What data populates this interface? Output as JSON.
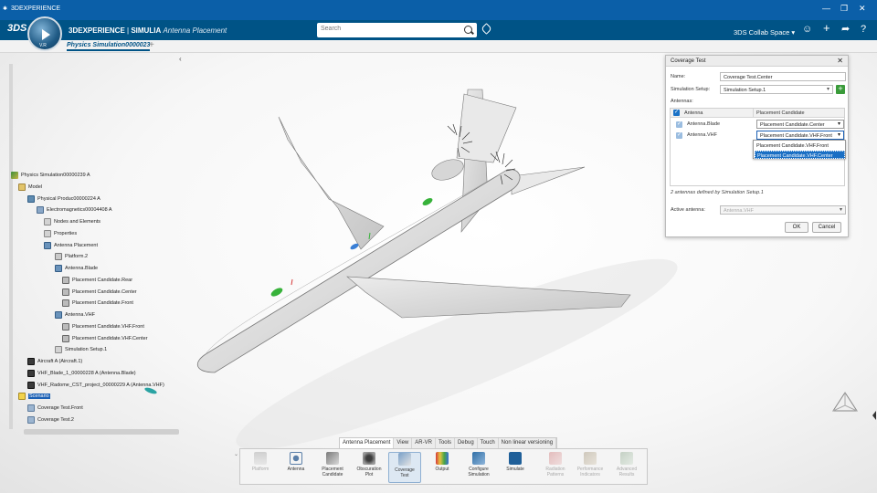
{
  "os": {
    "title": "3DEXPERIENCE",
    "controls": [
      "—",
      "❐",
      "✕"
    ]
  },
  "header": {
    "brand_main": "3DEXPERIENCE",
    "brand_sep": " | ",
    "brand_product": "SIMULIA",
    "app_name": "Antenna Placement",
    "compass_version": "V.R",
    "search_placeholder": "Search",
    "space": "3DS Collab Space",
    "icons": [
      "user-icon",
      "add-icon",
      "share-icon",
      "help-icon"
    ]
  },
  "tabs": {
    "active": "Physics Simulation0000023",
    "add": "+"
  },
  "tree": {
    "collapse_glyph": "‹",
    "nodes": [
      {
        "label": "Physics Simulation00000239 A",
        "icon": "simulation-icon",
        "depth": 0
      },
      {
        "label": "Model",
        "icon": "folder-icon",
        "depth": 1
      },
      {
        "label": "Physical Produc00000224 A",
        "icon": "product-icon",
        "depth": 2
      },
      {
        "label": "Electromagnetics00004408 A",
        "icon": "electromagnetics-icon",
        "depth": 3
      },
      {
        "label": "Nodes and Elements",
        "icon": "nodes-icon",
        "depth": 4
      },
      {
        "label": "Properties",
        "icon": "properties-icon",
        "depth": 4
      },
      {
        "label": "Antenna Placement",
        "icon": "antenna-placement-icon",
        "depth": 4
      },
      {
        "label": "Platform.2",
        "icon": "platform-icon",
        "depth": 5
      },
      {
        "label": "Antenna.Blade",
        "icon": "antenna-icon",
        "depth": 5
      },
      {
        "label": "Placement Candidate.Rear",
        "icon": "placement-candidate-icon",
        "depth": 6
      },
      {
        "label": "Placement Candidate.Center",
        "icon": "placement-candidate-icon",
        "depth": 6
      },
      {
        "label": "Placement Candidate.Front",
        "icon": "placement-candidate-icon",
        "depth": 6
      },
      {
        "label": "Antenna.VHF",
        "icon": "antenna-icon",
        "depth": 5
      },
      {
        "label": "Placement Candidate.VHF.Front",
        "icon": "placement-candidate-icon",
        "depth": 6
      },
      {
        "label": "Placement Candidate.VHF.Center",
        "icon": "placement-candidate-icon",
        "depth": 6
      },
      {
        "label": "Simulation Setup.1",
        "icon": "simulation-setup-icon",
        "depth": 5
      },
      {
        "label": "Aircraft A (Aircraft.1)",
        "icon": "part-icon",
        "depth": 2
      },
      {
        "label": "VHF_Blade_1_00000228 A (Antenna.Blade)",
        "icon": "part-icon",
        "depth": 2
      },
      {
        "label": "VHF_Radome_CST_project_00000229 A (Antenna.VHF)",
        "icon": "part-icon",
        "depth": 2
      },
      {
        "label": "Scenario",
        "icon": "scenario-icon",
        "depth": 1,
        "selected": true
      },
      {
        "label": "Coverage Test.Front",
        "icon": "coverage-icon",
        "depth": 2
      },
      {
        "label": "Coverage Test.2",
        "icon": "coverage-icon",
        "depth": 2
      }
    ]
  },
  "dialog": {
    "title": "Coverage Test",
    "close": "✕",
    "name_label": "Name:",
    "name_value": "Coverage Test.Center",
    "setup_label": "Simulation Setup:",
    "setup_value": "Simulation Setup.1",
    "add_glyph": "+",
    "antennas_label": "Antennas:",
    "col_antenna": "Antenna",
    "col_candidate": "Placement Candidate",
    "rows": [
      {
        "antenna": "Antenna.Blade",
        "candidate": "Placement Candidate.Center"
      },
      {
        "antenna": "Antenna.VHF",
        "candidate": "Placement Candidate.VHF.Front"
      }
    ],
    "options": [
      "Placement Candidate.VHF.Front",
      "Placement Candidate.VHF.Center"
    ],
    "highlighted_option": 1,
    "note": "2 antennas defined by Simulation Setup.1",
    "active_label": "Active antenna:",
    "active_value": "Antenna.VHF",
    "ok": "OK",
    "cancel": "Cancel"
  },
  "toolbar": {
    "tabs": [
      "Antenna Placement",
      "View",
      "AR-VR",
      "Tools",
      "Debug",
      "Touch",
      "Non linear versioning"
    ],
    "active_tab": 0,
    "tools": [
      {
        "label": "Platform",
        "icon": "platform-icon",
        "enabled": false
      },
      {
        "label": "Antenna",
        "icon": "antenna-icon",
        "enabled": true
      },
      {
        "label": "Placement\nCandidate",
        "icon": "placement-candidate-icon",
        "enabled": true
      },
      {
        "label": "Obscuration\nPlot",
        "icon": "obscuration-plot-icon",
        "enabled": true
      },
      {
        "label": "Coverage\nTest",
        "icon": "coverage-test-icon",
        "enabled": true,
        "active": true
      },
      {
        "label": "Output",
        "icon": "output-icon",
        "enabled": true
      },
      {
        "label": "Configure\nSimulation",
        "icon": "configure-simulation-icon",
        "enabled": true
      },
      {
        "label": "Simulate",
        "icon": "simulate-icon",
        "enabled": true
      },
      {
        "label": "Radiation\nPatterns",
        "icon": "radiation-patterns-icon",
        "enabled": false
      },
      {
        "label": "Performance\nIndicators",
        "icon": "performance-indicators-icon",
        "enabled": false
      },
      {
        "label": "Advanced\nResults",
        "icon": "advanced-results-icon",
        "enabled": false
      }
    ]
  },
  "colors": {
    "os_bar": "#0b5fa8",
    "header": "#005386",
    "accent": "#1a6fc4",
    "marker_green": "#37b23a",
    "marker_blue": "#3a7fd6",
    "marker_teal": "#2aa3a3"
  }
}
